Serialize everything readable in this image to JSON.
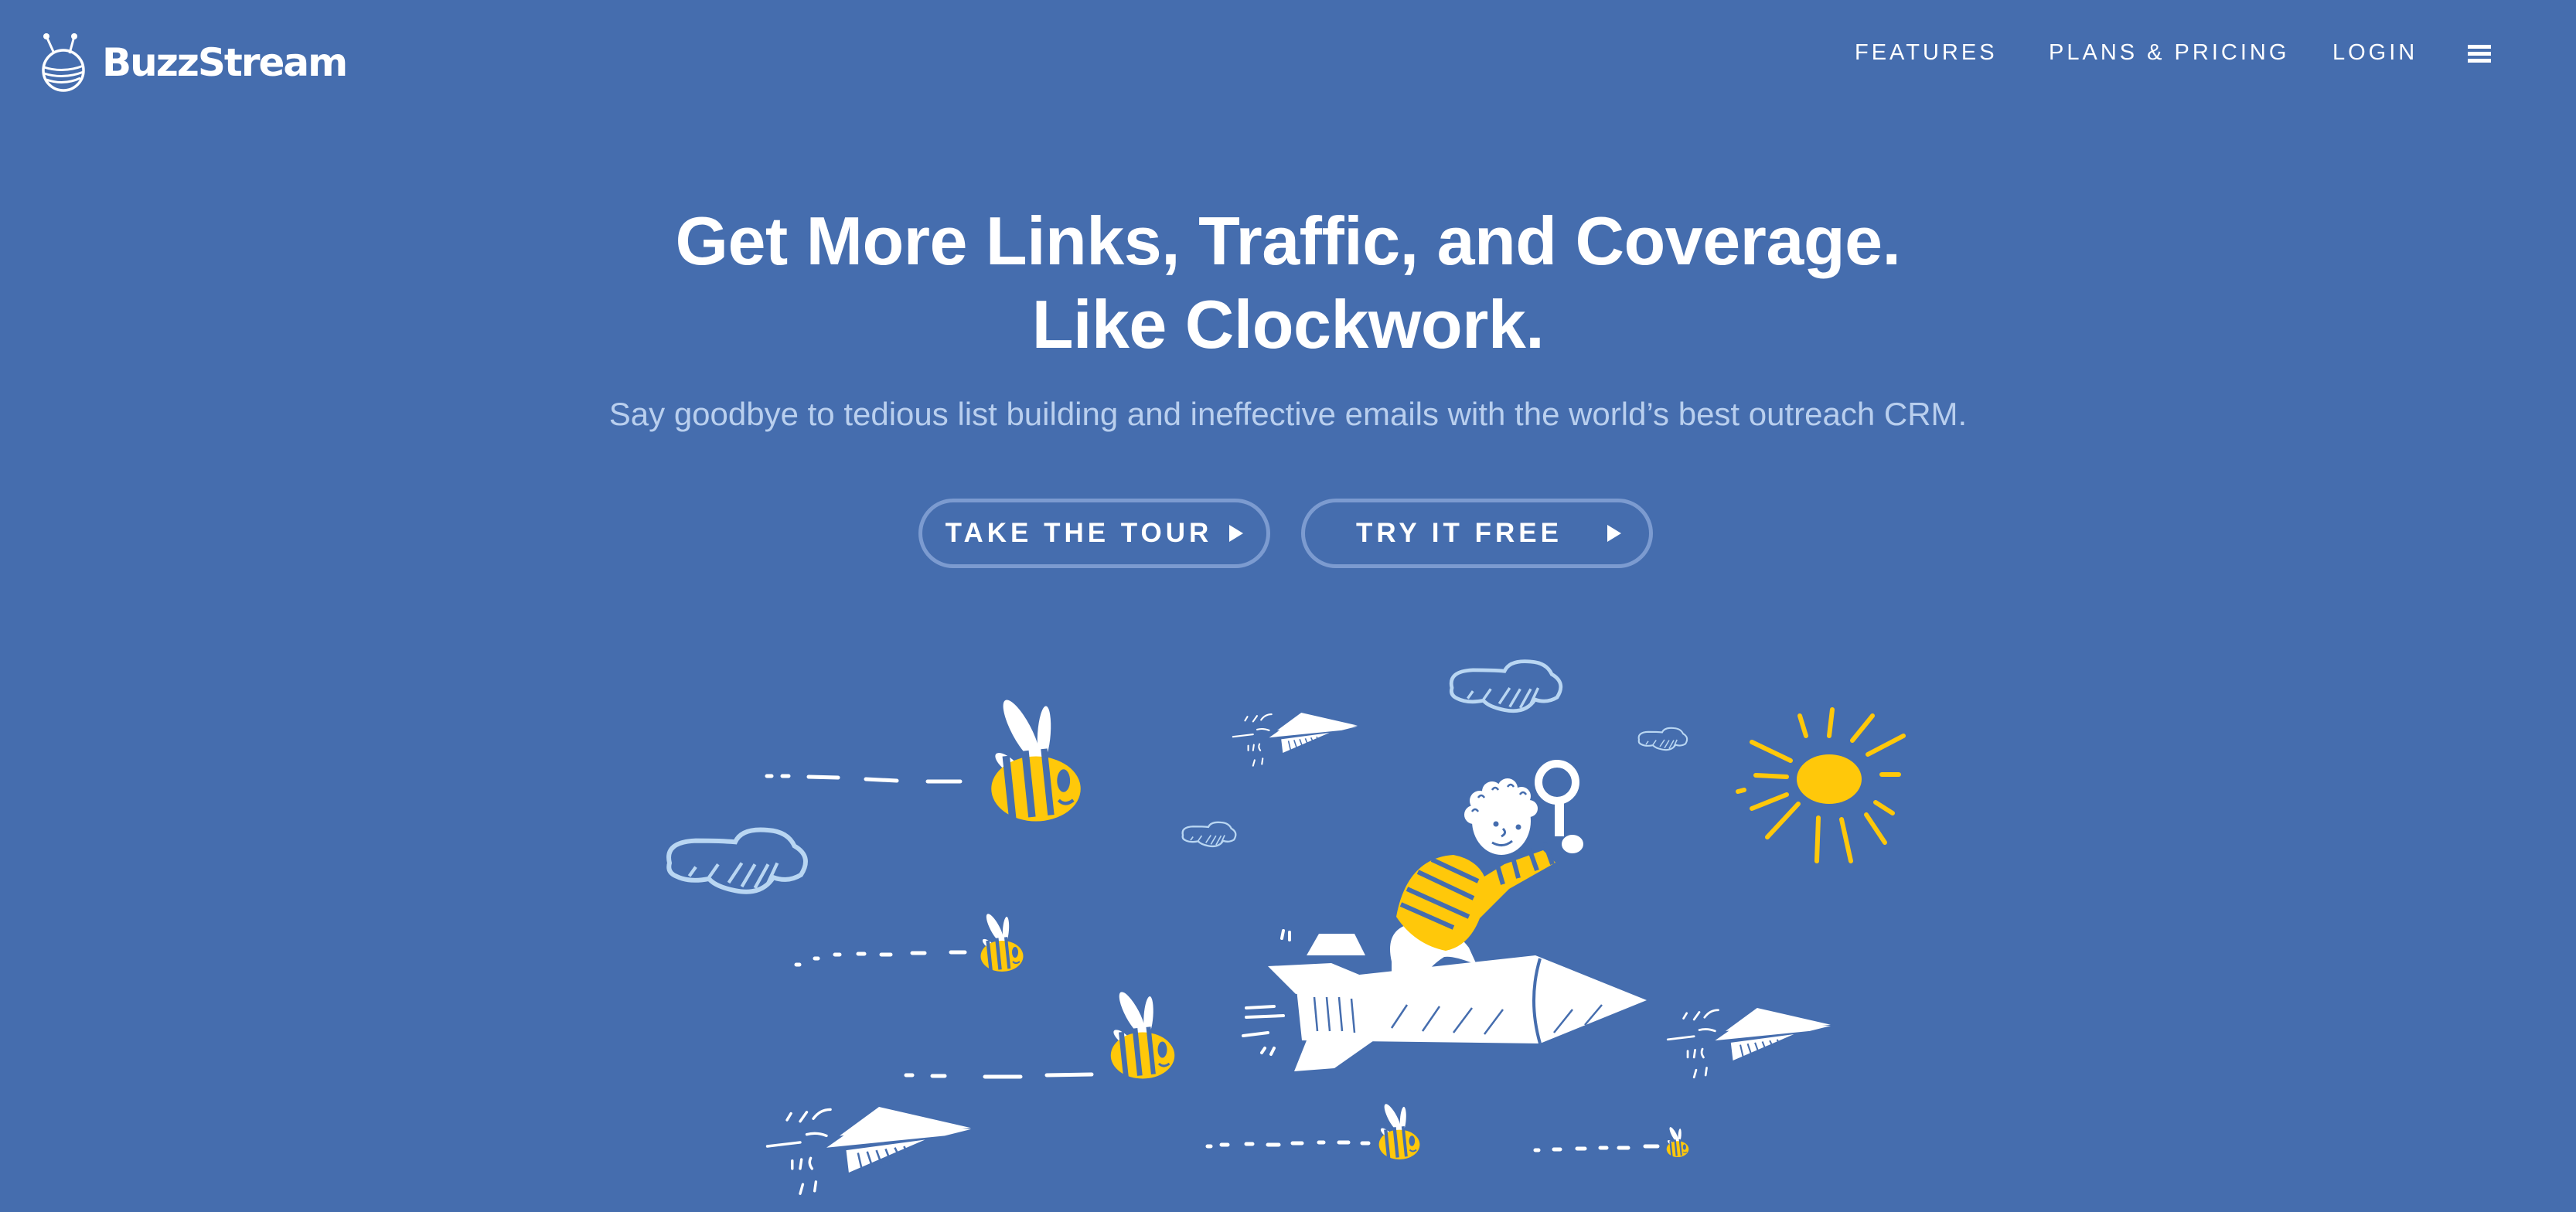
{
  "brand": {
    "name": "BuzzStream",
    "logo_icon": "bee-ball-logo"
  },
  "nav": {
    "items": [
      {
        "label": "FEATURES"
      },
      {
        "label": "PLANS & PRICING"
      },
      {
        "label": "LOGIN"
      }
    ],
    "menu_icon": "hamburger-menu-icon"
  },
  "hero": {
    "headline_line1": "Get More Links, Traffic, and Coverage.",
    "headline_line2": "Like Clockwork.",
    "subheadline": "Say goodbye to tedious list building and ineffective emails with the world’s best outreach CRM.",
    "buttons": [
      {
        "label": "TAKE THE TOUR",
        "icon": "play-triangle-icon"
      },
      {
        "label": "TRY IT FREE",
        "icon": "play-triangle-icon"
      }
    ]
  },
  "illustration": {
    "description": "Boy with magnifying glass riding a rocket, surrounded by bees, paper planes, clouds and a sun",
    "elements": [
      "bee",
      "bee",
      "bee",
      "bee",
      "bee",
      "paper-plane",
      "paper-plane",
      "paper-plane",
      "cloud",
      "cloud",
      "cloud",
      "cloud",
      "sun",
      "rocket",
      "boy",
      "magnifying-glass"
    ]
  },
  "colors": {
    "background": "#456DAE",
    "accent_yellow": "#FFC80A",
    "cloud": "#B9D6F2",
    "button_border": "#7C9BD0",
    "subtext": "#B9CFEE"
  }
}
